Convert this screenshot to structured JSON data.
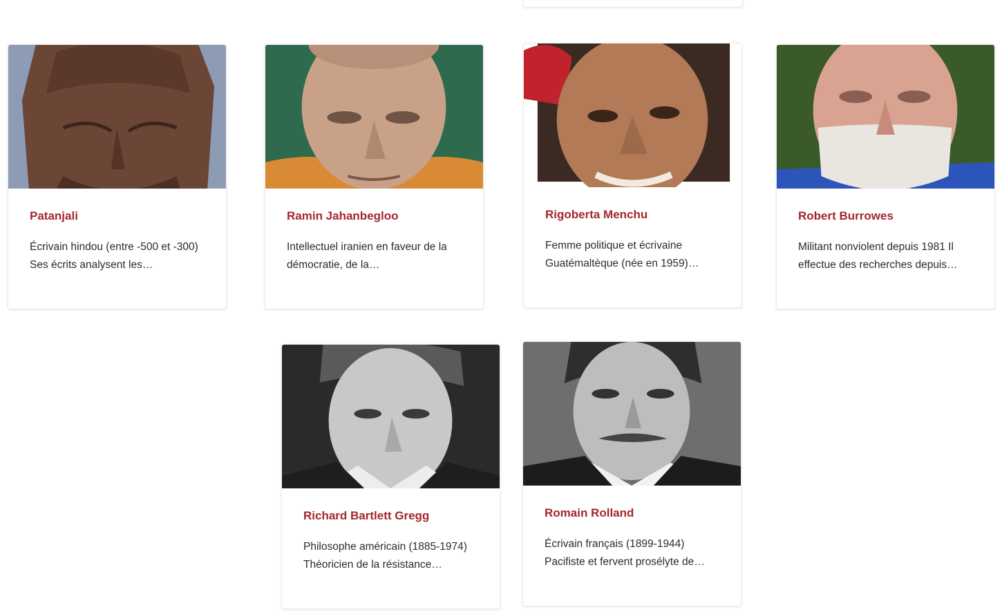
{
  "cards": [
    {
      "name": "Patanjali",
      "desc": "Écrivain hindou (entre -500 et -300) Ses écrits analysent les…"
    },
    {
      "name": "Ramin Jahanbegloo",
      "desc": "Intellectuel iranien en faveur de la démocratie, de la…"
    },
    {
      "name": "Rigoberta Menchu",
      "desc": "Femme politique et écrivaine Guatémaltèque (née en 1959)…"
    },
    {
      "name": "Robert Burrowes",
      "desc": "Militant nonviolent depuis 1981 Il effectue des recherches depuis…"
    },
    {
      "name": "Richard Bartlett Gregg",
      "desc": "Philosophe américain (1885-1974) Théoricien de la résistance…"
    },
    {
      "name": "Romain Rolland",
      "desc": "Écrivain français (1899-1944) Pacifiste et fervent prosélyte de…"
    }
  ],
  "colors": {
    "accent": "#a3262b",
    "text": "#2b2b2b"
  }
}
